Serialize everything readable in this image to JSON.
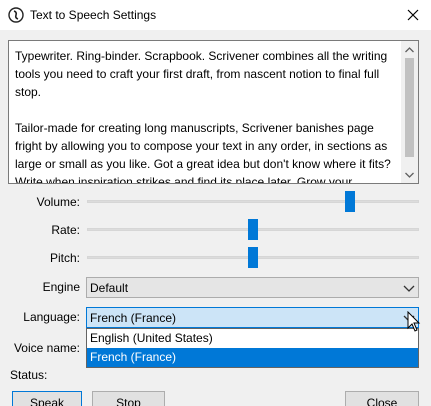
{
  "window": {
    "title": "Text to Speech Settings",
    "app_icon": "scrivener-app-icon",
    "close_icon": "close-icon"
  },
  "text": {
    "paragraphs": [
      "Typewriter. Ring-binder. Scrapbook. Scrivener combines all the writing tools you need to craft your first draft, from nascent notion to final full stop.",
      "Tailor-made for creating long manuscripts, Scrivener banishes page fright by allowing you to compose your text in any order, in sections as large or small as you like. Got a great idea but don't know where it fits? Write when inspiration strikes and find its place later. Grow your"
    ]
  },
  "labels": {
    "volume": "Volume:",
    "rate": "Rate:",
    "pitch": "Pitch:",
    "engine": "Engine",
    "language": "Language:",
    "voice_name": "Voice name:",
    "status": "Status:"
  },
  "sliders": {
    "volume": 0.8,
    "rate": 0.5,
    "pitch": 0.5
  },
  "engine": {
    "selected": "Default"
  },
  "language": {
    "selected": "French (France)",
    "options": [
      "English (United States)",
      "French (France)"
    ],
    "highlighted": "French (France)"
  },
  "buttons": {
    "speak": "Speak",
    "stop": "Stop",
    "close": "Close"
  },
  "colors": {
    "accent": "#0078d7",
    "selection_bg": "#cce4f7"
  }
}
